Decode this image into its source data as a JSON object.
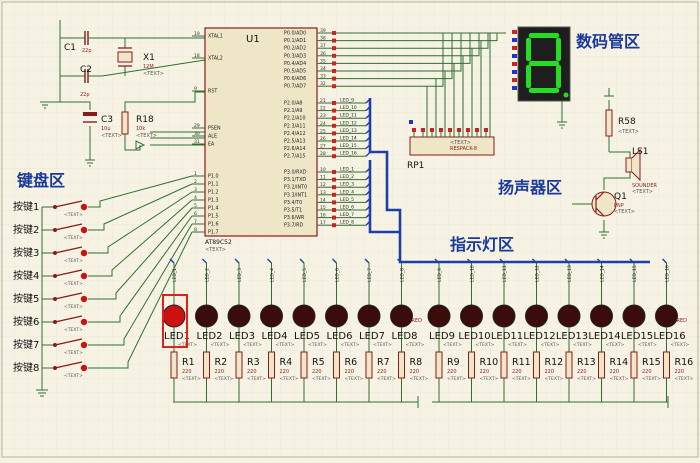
{
  "regions": {
    "keyboard": "键盘区",
    "seg_display": "数码管区",
    "speaker": "扬声器区",
    "indicator": "指示灯区"
  },
  "mcu": {
    "ref": "U1",
    "part": "AT89C52",
    "left_pins": [
      {
        "num": "19",
        "name": "XTAL1"
      },
      {
        "num": "18",
        "name": "XTAL2"
      },
      {
        "num": "9",
        "name": "RST"
      },
      {
        "num": "29",
        "name": "PSEN"
      },
      {
        "num": "30",
        "name": "ALE"
      },
      {
        "num": "31",
        "name": "EA"
      },
      {
        "num": "1",
        "name": "P1.0"
      },
      {
        "num": "2",
        "name": "P1.1"
      },
      {
        "num": "3",
        "name": "P1.2"
      },
      {
        "num": "4",
        "name": "P1.3"
      },
      {
        "num": "5",
        "name": "P1.4"
      },
      {
        "num": "6",
        "name": "P1.5"
      },
      {
        "num": "7",
        "name": "P1.6"
      },
      {
        "num": "8",
        "name": "P1.7"
      }
    ],
    "p0_pins": [
      {
        "num": "39",
        "name": "P0.0/AD0"
      },
      {
        "num": "38",
        "name": "P0.1/AD1"
      },
      {
        "num": "37",
        "name": "P0.2/AD2"
      },
      {
        "num": "36",
        "name": "P0.3/AD3"
      },
      {
        "num": "35",
        "name": "P0.4/AD4"
      },
      {
        "num": "34",
        "name": "P0.5/AD5"
      },
      {
        "num": "33",
        "name": "P0.6/AD6"
      },
      {
        "num": "32",
        "name": "P0.7/AD7"
      }
    ],
    "p2_pins": [
      {
        "num": "21",
        "name": "P2.0/A8",
        "net": "LED_9"
      },
      {
        "num": "22",
        "name": "P2.1/A9",
        "net": "LED_10"
      },
      {
        "num": "23",
        "name": "P2.2/A10",
        "net": "LED_11"
      },
      {
        "num": "24",
        "name": "P2.3/A11",
        "net": "LED_12"
      },
      {
        "num": "25",
        "name": "P2.4/A12",
        "net": "LED_13"
      },
      {
        "num": "26",
        "name": "P2.5/A13",
        "net": "LED_14"
      },
      {
        "num": "27",
        "name": "P2.6/A14",
        "net": "LED_15"
      },
      {
        "num": "28",
        "name": "P2.7/A15",
        "net": "LED_16"
      }
    ],
    "p3_pins": [
      {
        "num": "10",
        "name": "P3.0/RXD",
        "net": "LED_1"
      },
      {
        "num": "11",
        "name": "P3.1/TXD",
        "net": "LED_2"
      },
      {
        "num": "12",
        "name": "P3.2/INT0",
        "net": "LED_3"
      },
      {
        "num": "13",
        "name": "P3.3/INT1",
        "net": "LED_4"
      },
      {
        "num": "14",
        "name": "P3.4/T0",
        "net": "LED_5"
      },
      {
        "num": "15",
        "name": "P3.5/T1",
        "net": "LED_6"
      },
      {
        "num": "16",
        "name": "P3.6/WR",
        "net": "LED_7"
      },
      {
        "num": "17",
        "name": "P3.7/RD",
        "net": "LED_8"
      }
    ]
  },
  "parts": {
    "c1": {
      "ref": "C1",
      "value": "22p"
    },
    "c2": {
      "ref": "C2",
      "value": "22p"
    },
    "x1": {
      "ref": "X1",
      "value": "12M"
    },
    "c3": {
      "ref": "C3",
      "value": "10u"
    },
    "r18": {
      "ref": "R18",
      "value": "10k"
    },
    "rp1": {
      "ref": "RP1",
      "value": "RESPACK-8"
    },
    "r58": {
      "ref": "R58"
    },
    "ls1": {
      "ref": "LS1",
      "value": "SOUNDER"
    },
    "q1": {
      "ref": "Q1",
      "value": "PNP"
    }
  },
  "text_placeholder": "<TEXT>",
  "keys": [
    "按键1",
    "按键2",
    "按键3",
    "按键4",
    "按键5",
    "按键6",
    "按键7",
    "按键8"
  ],
  "leds": [
    "LED1",
    "LED2",
    "LED3",
    "LED4",
    "LED5",
    "LED6",
    "LED7",
    "LED8",
    "LED9",
    "LED10",
    "LED11",
    "LED12",
    "LED13",
    "LED14",
    "LED15",
    "LED16"
  ],
  "led_type": "RED",
  "resistors": [
    "R1",
    "R2",
    "R3",
    "R4",
    "R5",
    "R6",
    "R7",
    "R8",
    "R9",
    "R10",
    "R11",
    "R12",
    "R13",
    "R14",
    "R15",
    "R16"
  ],
  "resistor_value": "220",
  "seg_digit": "8",
  "colors": {
    "background": "#f7f3e4",
    "grid": "#e6e0c8",
    "wire": "#2f6f2f",
    "bus": "#1e3fa8",
    "component": "#8b1a1a",
    "chip_fill": "#efe6c8",
    "label_blue": "#1a3a9a",
    "seg_bg": "#1e1e1e",
    "seg_on": "#22dd22",
    "led_off": "#3a0c0c",
    "led_on": "#cc1111",
    "highlight": "#e02020",
    "pin_red": "#cc2222",
    "pin_blue": "#2233cc"
  }
}
